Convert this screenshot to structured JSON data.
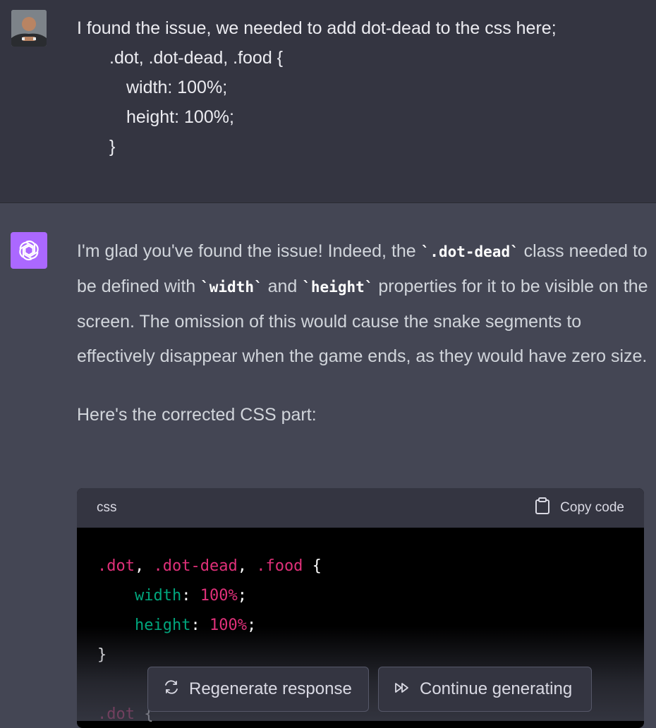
{
  "user": {
    "lines": [
      "I found the issue, we needed to add dot-dead to the css here;",
      ".dot, .dot-dead, .food {",
      "width: 100%;",
      "height: 100%;",
      "}"
    ]
  },
  "assistant": {
    "p1": {
      "a": "I'm glad you've found the issue! Indeed, the ",
      "code1": "`.dot-dead`",
      "b": " class needed to be defined with ",
      "code2": "`width`",
      "c": " and ",
      "code3": "`height`",
      "d": " properties for it to be visible on the screen. The omission of this would cause the snake segments to effectively disappear when the game ends, as they would have zero size."
    },
    "p2": "Here's the corrected CSS part:",
    "code_block": {
      "language": "css",
      "copy_label": "Copy code",
      "tokens": {
        "sel1": ".dot",
        "comma1": ", ",
        "sel2": ".dot-dead",
        "comma2": ", ",
        "sel3": ".food",
        "open": " {",
        "prop1": "width",
        "colon": ": ",
        "val1": "100%",
        "semi": ";",
        "prop2": "height",
        "val2": "100%",
        "close": "}",
        "sel4": ".dot",
        "open2": " {"
      }
    }
  },
  "actions": {
    "regenerate": "Regenerate response",
    "continue": "Continue generating"
  },
  "colors": {
    "accent": "#ab68ff",
    "selector": "#df3079",
    "property": "#00a67d"
  }
}
